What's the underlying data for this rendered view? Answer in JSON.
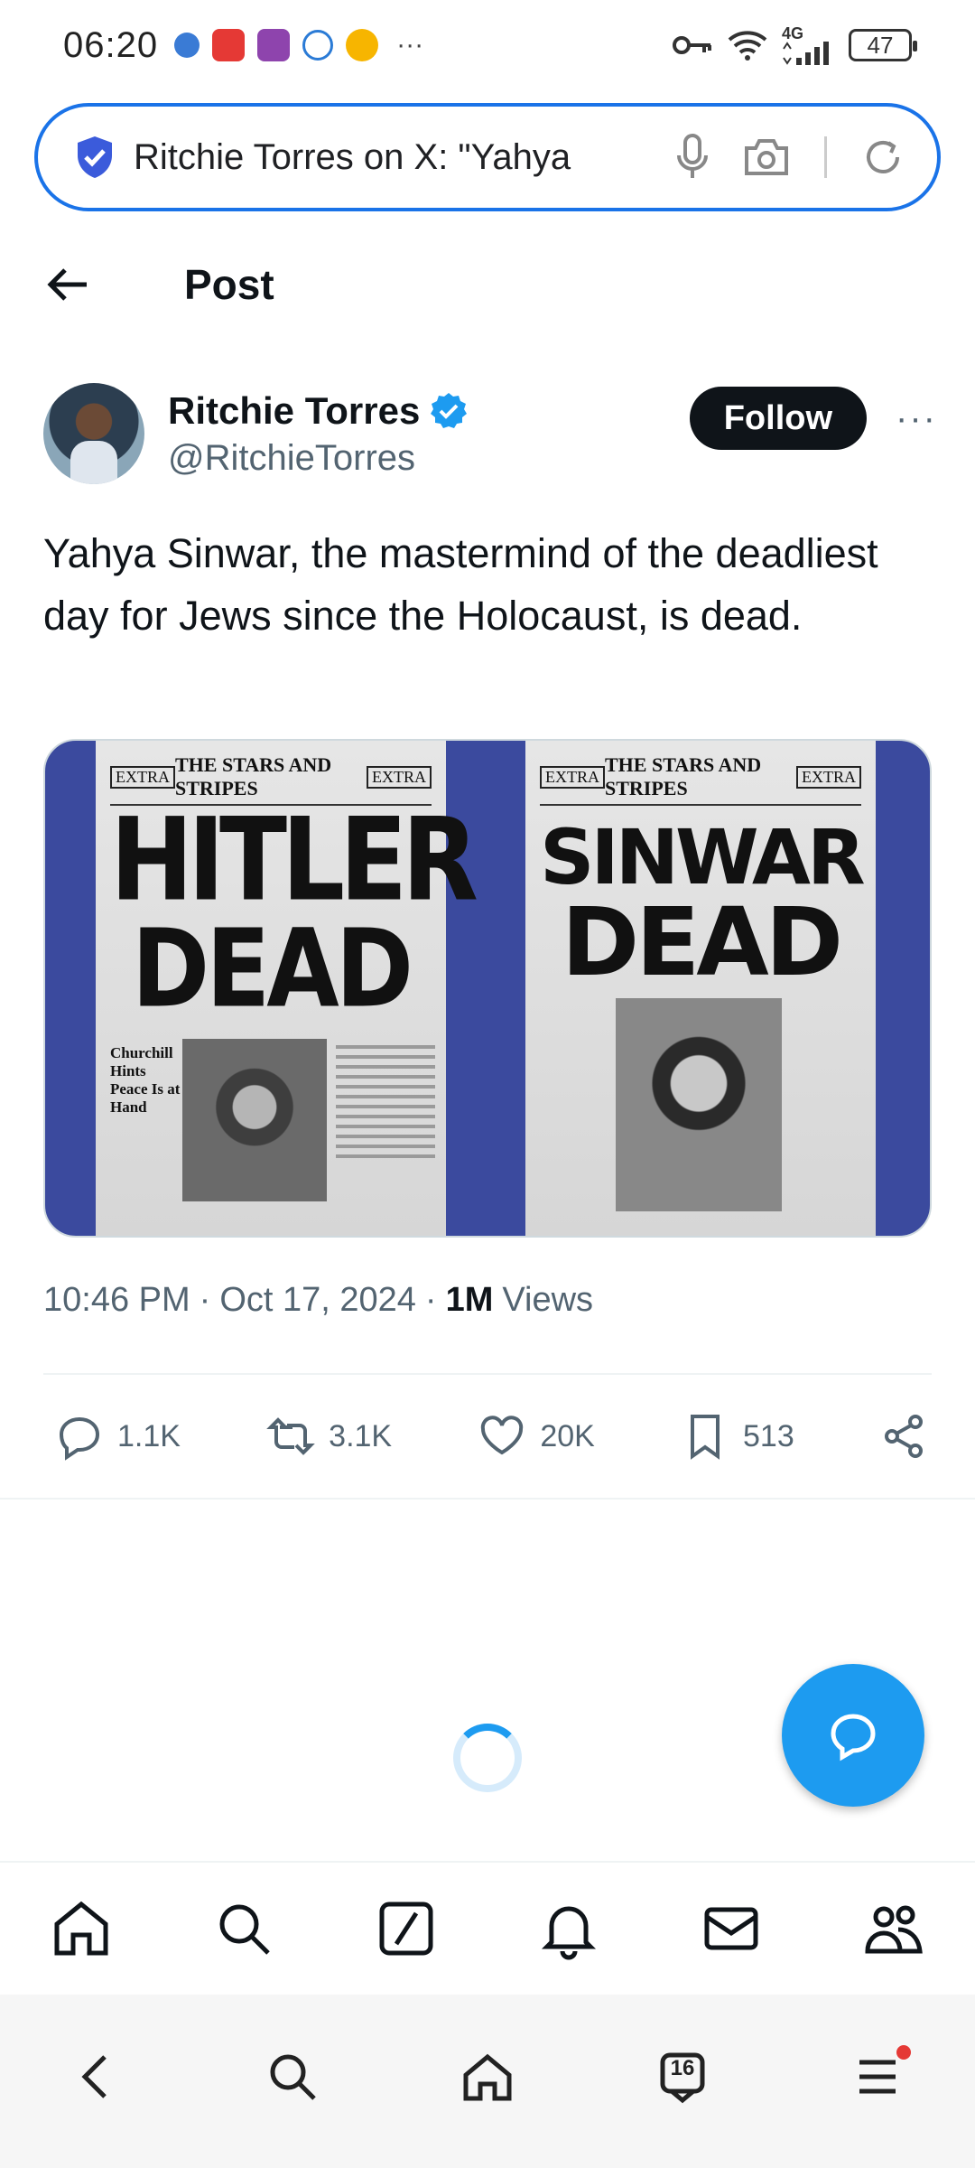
{
  "status_bar": {
    "time": "06:20",
    "network": "4G",
    "battery": "47",
    "more": "···"
  },
  "browser": {
    "url_text": "Ritchie Torres on X: \"Yahya"
  },
  "header": {
    "title": "Post"
  },
  "author": {
    "name": "Ritchie Torres",
    "handle": "@RitchieTorres",
    "follow_label": "Follow",
    "more": "···"
  },
  "tweet": {
    "text": "Yahya Sinwar, the mastermind of the deadliest day for Jews since the Holocaust, is dead."
  },
  "media": {
    "left": {
      "extra": "EXTRA",
      "masthead": "THE STARS AND STRIPES",
      "headline_1": "HITLER",
      "headline_2": "DEAD",
      "side_head": "Churchill Hints Peace Is at Hand"
    },
    "right": {
      "extra": "EXTRA",
      "masthead": "THE STARS AND STRIPES",
      "headline_1": "SINWAR",
      "headline_2": "DEAD"
    }
  },
  "meta": {
    "time": "10:46 PM",
    "date": "Oct 17, 2024",
    "views_count": "1M",
    "views_label": "Views",
    "separator": "·"
  },
  "actions": {
    "replies": "1.1K",
    "reposts": "3.1K",
    "likes": "20K",
    "bookmarks": "513"
  },
  "browser_nav": {
    "tab_count": "16"
  },
  "colors": {
    "accent": "#1d9bf0",
    "url_border": "#1a73e8",
    "text_primary": "#0f1419",
    "text_secondary": "#536471",
    "media_bg": "#3b4a9e"
  }
}
